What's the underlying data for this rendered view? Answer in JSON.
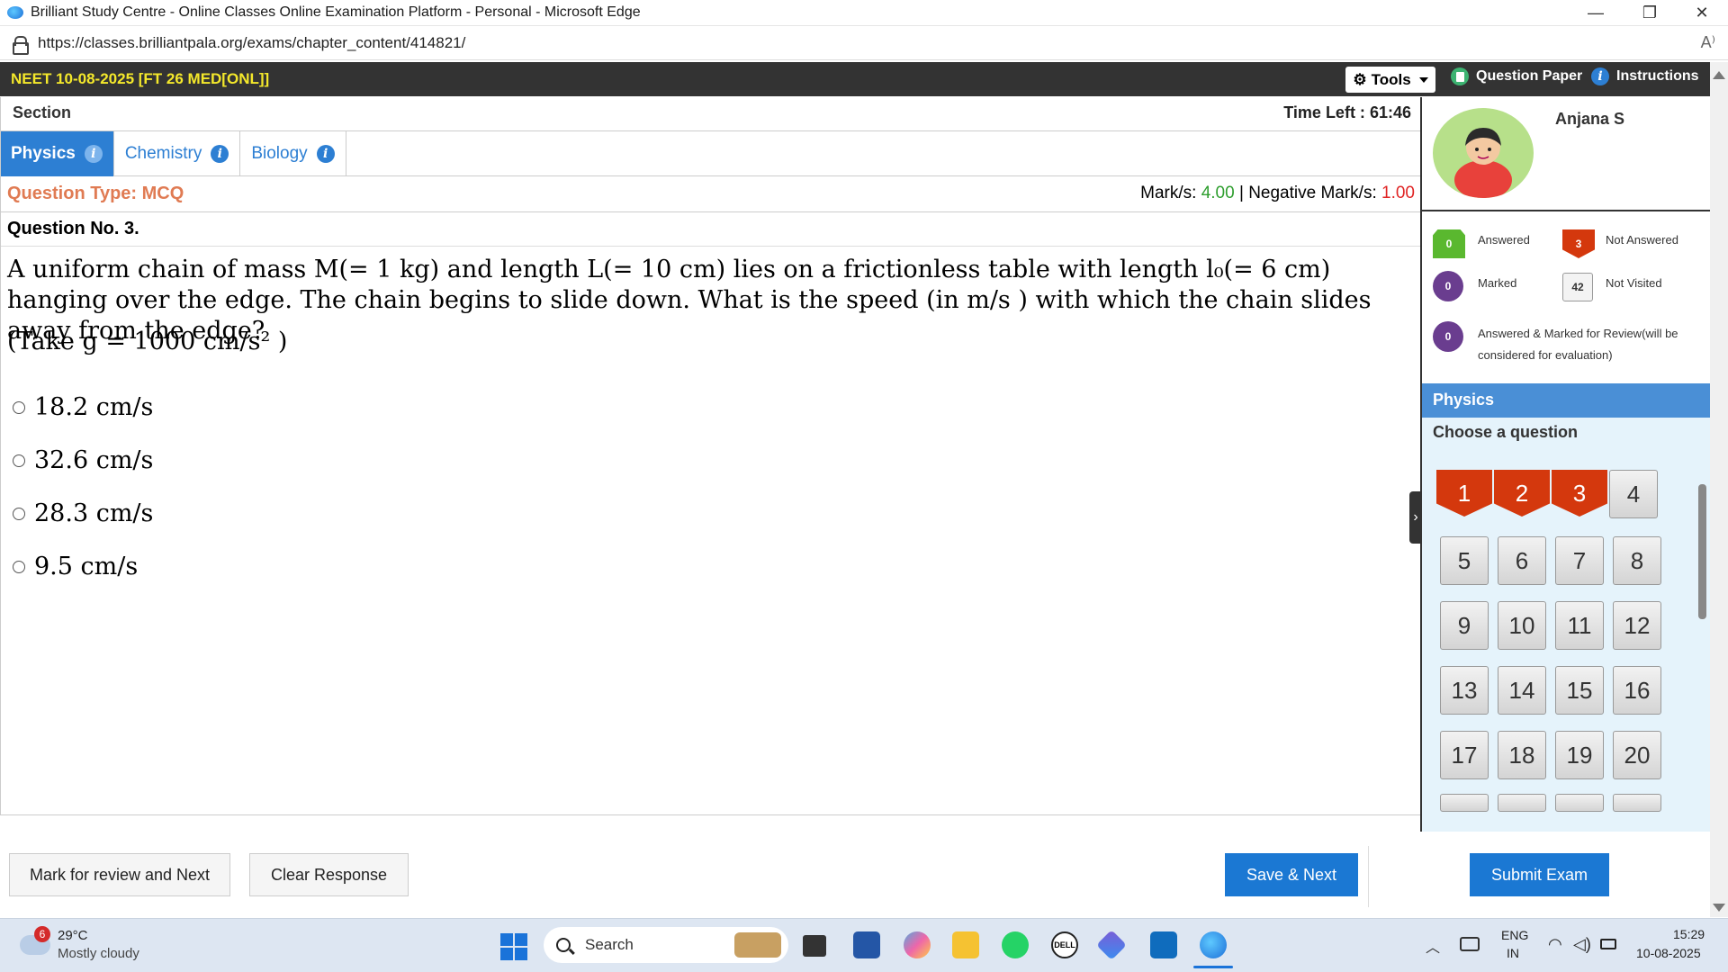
{
  "browser": {
    "title": "Brilliant Study Centre - Online Classes Online Examination Platform - Personal - Microsoft Edge",
    "url": "https://classes.brilliantpala.org/exams/chapter_content/414821/",
    "minimize": "—",
    "maximize": "❐",
    "close": "✕",
    "read_aloud": "A⁾"
  },
  "exam": {
    "name": "NEET 10-08-2025 [FT 26 MED[ONL]]",
    "tools_label": "Tools",
    "question_paper_label": "Question Paper",
    "instructions_label": "Instructions"
  },
  "section": {
    "label": "Section",
    "time_left_label": "Time Left :",
    "time_left_value": "61:46",
    "tabs": [
      {
        "label": "Physics",
        "active": true
      },
      {
        "label": "Chemistry",
        "active": false
      },
      {
        "label": "Biology",
        "active": false
      }
    ]
  },
  "question": {
    "type_label": "Question Type: MCQ",
    "marks_label": "Mark/s:",
    "marks_value": "4.00",
    "sep": "|",
    "neg_label": "Negative Mark/s:",
    "neg_value": "1.00",
    "number_label": "Question No. 3.",
    "text": "A uniform chain of mass M(= 1 kg) and length L(= 10 cm) lies on a frictionless table with length l₀(= 6 cm) hanging over the edge. The chain begins to slide down. What is the speed (in m/s ) with which the chain slides away from the edge?",
    "note": "(Take g = 1000 cm/s² )",
    "options": [
      "18.2 cm/s",
      "32.6 cm/s",
      "28.3 cm/s",
      "9.5 cm/s"
    ]
  },
  "profile": {
    "name": "Anjana S"
  },
  "legend": {
    "answered": {
      "count": "0",
      "label": "Answered"
    },
    "not_answered": {
      "count": "3",
      "label": "Not Answered"
    },
    "marked": {
      "count": "0",
      "label": "Marked"
    },
    "not_visited": {
      "count": "42",
      "label": "Not Visited"
    },
    "answered_marked": {
      "count": "0",
      "label": "Answered & Marked for Review(will be considered for evaluation)"
    }
  },
  "palette": {
    "section": "Physics",
    "choose_label": "Choose a question",
    "questions": [
      {
        "n": "1",
        "status": "not_answered"
      },
      {
        "n": "2",
        "status": "not_answered"
      },
      {
        "n": "3",
        "status": "not_answered"
      },
      {
        "n": "4",
        "status": "not_visited"
      },
      {
        "n": "5",
        "status": "not_visited"
      },
      {
        "n": "6",
        "status": "not_visited"
      },
      {
        "n": "7",
        "status": "not_visited"
      },
      {
        "n": "8",
        "status": "not_visited"
      },
      {
        "n": "9",
        "status": "not_visited"
      },
      {
        "n": "10",
        "status": "not_visited"
      },
      {
        "n": "11",
        "status": "not_visited"
      },
      {
        "n": "12",
        "status": "not_visited"
      },
      {
        "n": "13",
        "status": "not_visited"
      },
      {
        "n": "14",
        "status": "not_visited"
      },
      {
        "n": "15",
        "status": "not_visited"
      },
      {
        "n": "16",
        "status": "not_visited"
      },
      {
        "n": "17",
        "status": "not_visited"
      },
      {
        "n": "18",
        "status": "not_visited"
      },
      {
        "n": "19",
        "status": "not_visited"
      },
      {
        "n": "20",
        "status": "not_visited"
      }
    ]
  },
  "actions": {
    "mark_review": "Mark for review and Next",
    "clear": "Clear Response",
    "save_next": "Save & Next",
    "submit": "Submit Exam"
  },
  "taskbar": {
    "weather_badge": "6",
    "temp": "29°C",
    "condition": "Mostly cloudy",
    "search": "Search",
    "lang1": "ENG",
    "lang2": "IN",
    "time": "15:29",
    "date": "10-08-2025"
  },
  "colors": {
    "accent_blue": "#2d7fd3",
    "not_answered": "#d4380d",
    "answered": "#5ab82f",
    "marked": "#6a3d8f",
    "exam_title_yellow": "#f4e82b",
    "question_type_orange": "#e07b53"
  }
}
